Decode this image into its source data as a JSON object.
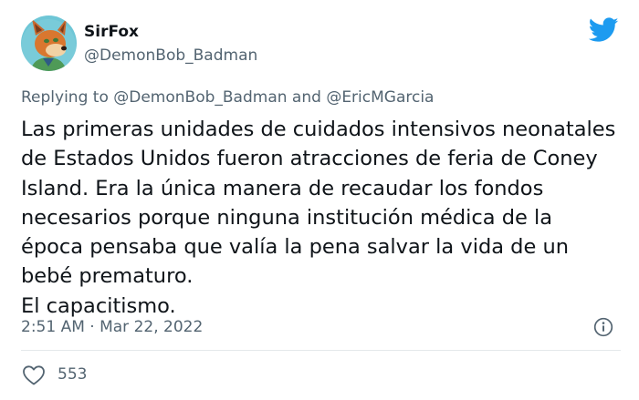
{
  "author": {
    "display_name": "SirFox",
    "handle": "@DemonBob_Badman",
    "avatar_icon": "fox-avatar"
  },
  "reply": {
    "prefix": "Replying to ",
    "mention_1": "@DemonBob_Badman",
    "connector": " and ",
    "mention_2": "@EricMGarcia"
  },
  "tweet": {
    "lines": [
      "Las primeras unidades de cuidados intensivos neonatales",
      "de Estados Unidos fueron atracciones de feria de Coney",
      "Island. Era la única manera de recaudar los fondos",
      "necesarios porque ninguna institución médica de la",
      "época pensaba que valía la pena salvar la vida de un",
      "bebé prematuro.",
      "El capacitismo."
    ]
  },
  "meta": {
    "timestamp": "2:51 AM · Mar 22, 2022"
  },
  "stats": {
    "likes": "553"
  },
  "colors": {
    "twitter_blue": "#1d9bf0",
    "text_primary": "#0f1419",
    "text_secondary": "#536471",
    "divider": "#e4e8eb"
  }
}
